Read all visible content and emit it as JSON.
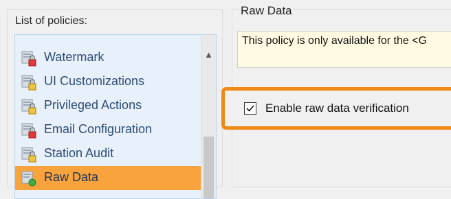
{
  "left_panel": {
    "heading": "List of policies:",
    "items": [
      {
        "label": "Watermark",
        "icon": "lock-red-icon",
        "selected": false
      },
      {
        "label": "UI Customizations",
        "icon": "lock-yellow-icon",
        "selected": false
      },
      {
        "label": "Privileged Actions",
        "icon": "lock-yellow-icon",
        "selected": false
      },
      {
        "label": "Email Configuration",
        "icon": "lock-red-icon",
        "selected": false
      },
      {
        "label": "Station Audit",
        "icon": "lock-yellow-icon",
        "selected": false
      },
      {
        "label": "Raw Data",
        "icon": "green-dot-icon",
        "selected": true
      }
    ]
  },
  "right_panel": {
    "heading": "Raw Data",
    "info_text": "This policy is only available for the <G",
    "checkbox": {
      "label": "Enable raw data verification",
      "checked": true
    }
  },
  "colors": {
    "selected_item": "#f9a33f",
    "highlight_border": "#ef8a17",
    "list_background": "#e8f1fb",
    "info_background": "#fffbe3"
  }
}
